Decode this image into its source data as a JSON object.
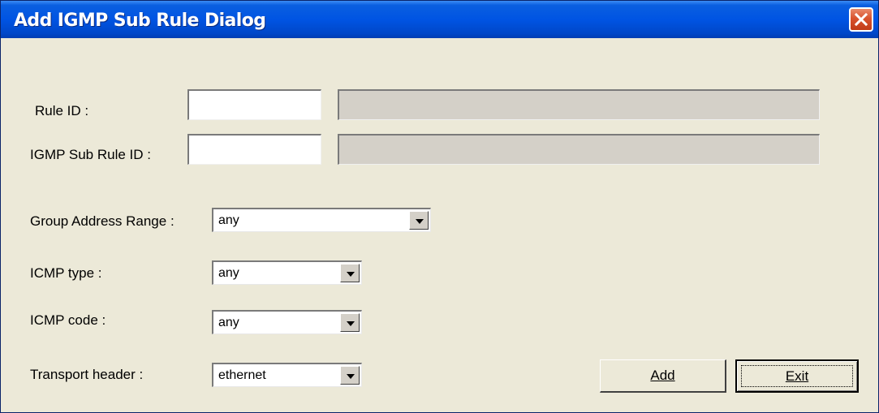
{
  "window": {
    "title": "Add IGMP Sub Rule Dialog"
  },
  "icons": {
    "close": "close-icon",
    "dropdown": "chevron-down-icon"
  },
  "form": {
    "rule_id": {
      "label": "Rule ID :",
      "value": "",
      "info": ""
    },
    "sub_rule_id": {
      "label": "IGMP Sub Rule ID :",
      "value": "",
      "info": ""
    },
    "group_address_range": {
      "label": "Group Address Range :",
      "selected": "any"
    },
    "icmp_type": {
      "label": "ICMP type :",
      "selected": "any"
    },
    "icmp_code": {
      "label": "ICMP code :",
      "selected": "any"
    },
    "transport_header": {
      "label": "Transport header :",
      "selected": "ethernet"
    }
  },
  "buttons": {
    "add_label": "Add",
    "exit_label": "Exit"
  },
  "colors": {
    "title_bar": "#0054e3",
    "dialog_bg": "#ece9d8",
    "close_button": "#d9532e"
  }
}
